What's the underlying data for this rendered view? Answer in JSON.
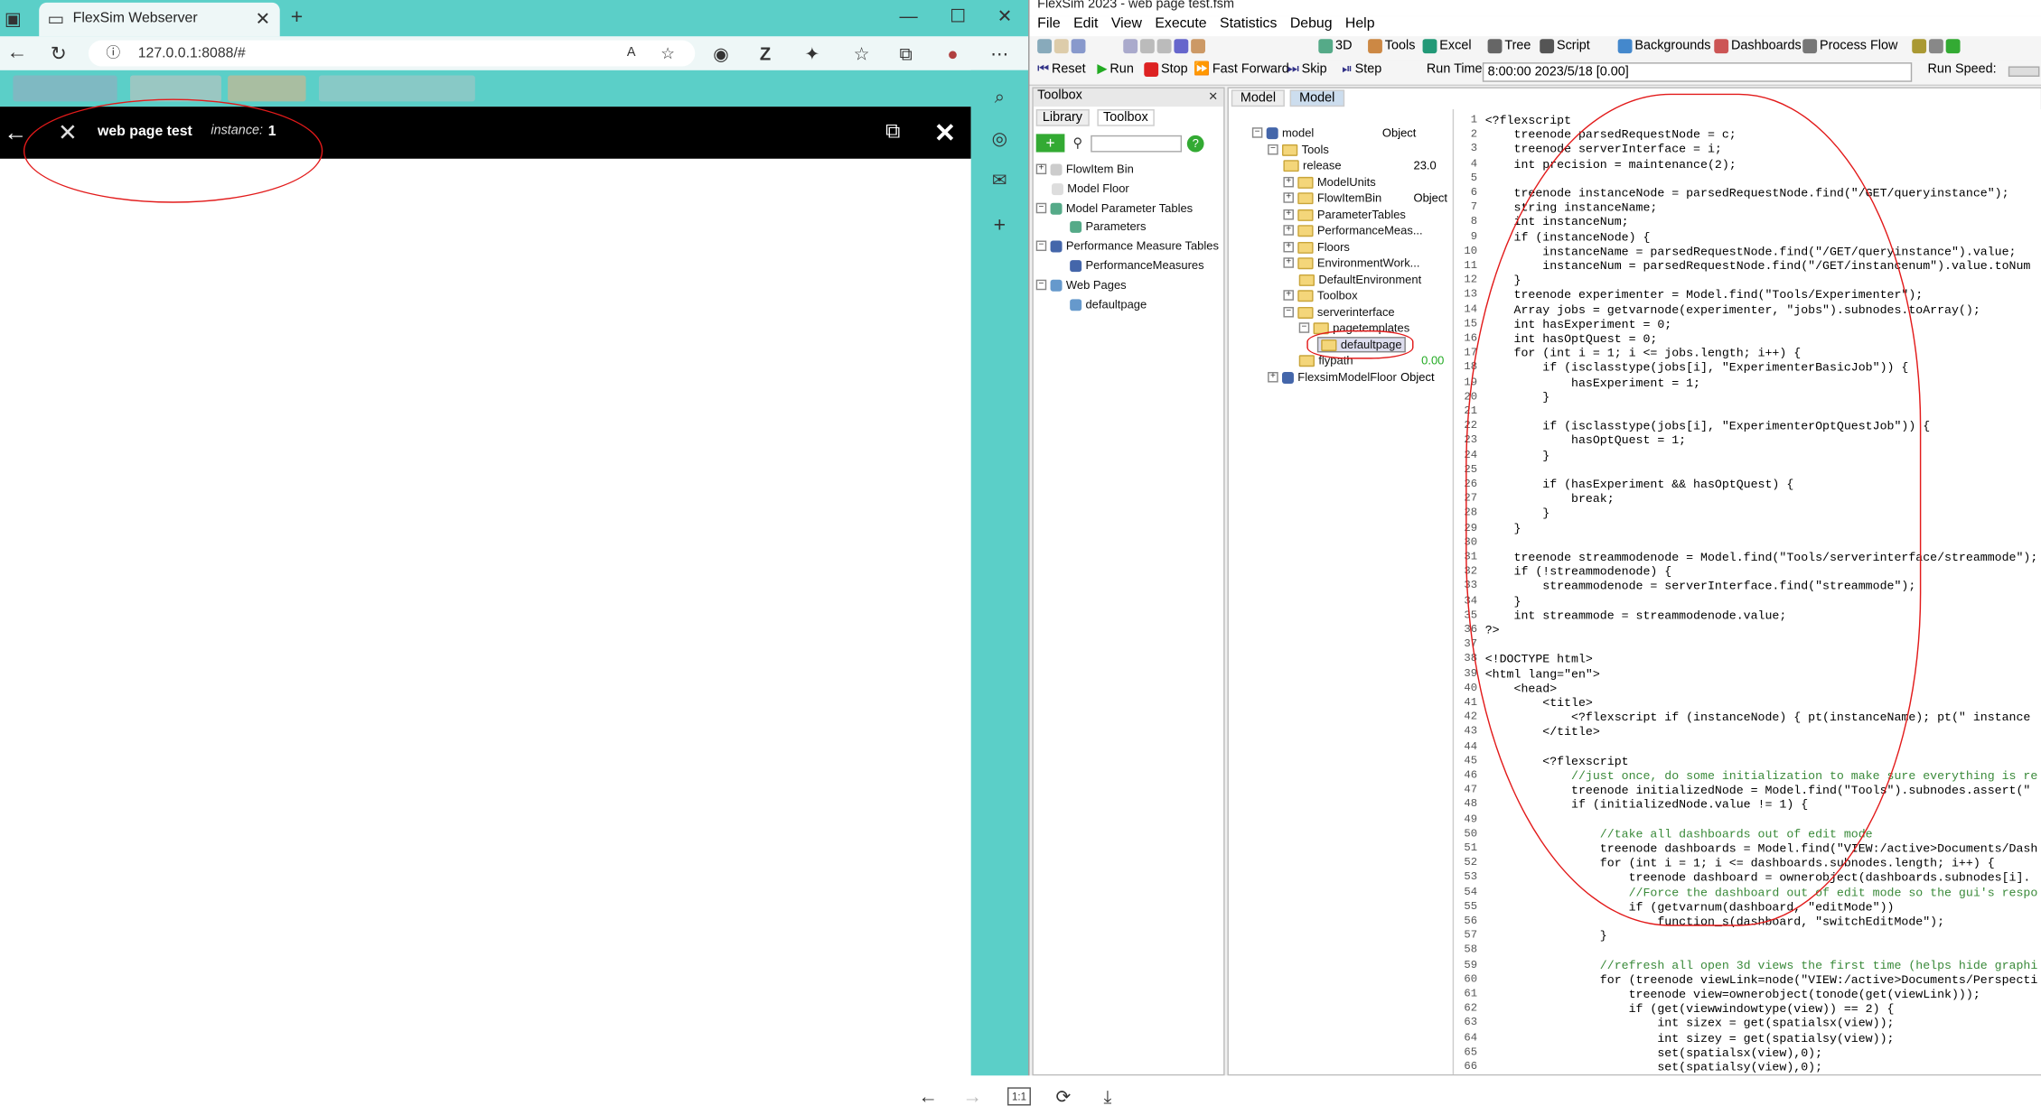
{
  "browser": {
    "tab_title": "FlexSim Webserver",
    "url": "127.0.0.1:8088/#",
    "app_title": "web page test",
    "instance_label": "instance:",
    "instance_value": "1"
  },
  "flexsim": {
    "window_title": "FlexSim 2023 - web page test.fsm",
    "menu": [
      "File",
      "Edit",
      "View",
      "Execute",
      "Statistics",
      "Debug",
      "Help"
    ],
    "toolbar": [
      "3D",
      "Tools",
      "Excel",
      "Tree",
      "Script",
      "Backgrounds",
      "Dashboards",
      "Process Flow"
    ],
    "run": {
      "reset": "Reset",
      "run": "Run",
      "stop": "Stop",
      "ff": "Fast Forward",
      "skip": "Skip",
      "step": "Step",
      "run_time_label": "Run Time:",
      "run_time": "8:00:00  2023/5/18  [0.00]",
      "run_speed_label": "Run Speed:"
    },
    "toolbox": {
      "title": "Toolbox",
      "tabs": [
        "Library",
        "Toolbox"
      ],
      "items": [
        "FlowItem Bin",
        "Model Floor",
        "Model Parameter Tables",
        "Parameters",
        "Performance Measure Tables",
        "PerformanceMeasures",
        "Web Pages",
        "defaultpage"
      ]
    },
    "model_tabs": [
      "Model",
      "Model"
    ],
    "tree": [
      {
        "name": "model",
        "value": "Object"
      },
      {
        "name": "Tools",
        "value": ""
      },
      {
        "name": "release",
        "value": "23.0"
      },
      {
        "name": "ModelUnits",
        "value": ""
      },
      {
        "name": "FlowItemBin",
        "value": "Object"
      },
      {
        "name": "ParameterTables",
        "value": ""
      },
      {
        "name": "PerformanceMeas...",
        "value": ""
      },
      {
        "name": "Floors",
        "value": ""
      },
      {
        "name": "EnvironmentWork...",
        "value": ""
      },
      {
        "name": "DefaultEnvironment",
        "value": ""
      },
      {
        "name": "Toolbox",
        "value": ""
      },
      {
        "name": "serverinterface",
        "value": ""
      },
      {
        "name": "pagetemplates",
        "value": ""
      },
      {
        "name": "defaultpage",
        "value": ""
      },
      {
        "name": "flypath",
        "value": "0.00"
      },
      {
        "name": "FlexsimModelFloor",
        "value": "Object"
      }
    ],
    "code": [
      "<?flexscript",
      "    treenode parsedRequestNode = c;",
      "    treenode serverInterface = i;",
      "    int precision = maintenance(2);",
      "",
      "    treenode instanceNode = parsedRequestNode.find(\"/GET/queryinstance\");",
      "    string instanceName;",
      "    int instanceNum;",
      "    if (instanceNode) {",
      "        instanceName = parsedRequestNode.find(\"/GET/queryinstance\").value;",
      "        instanceNum = parsedRequestNode.find(\"/GET/instancenum\").value.toNum",
      "    }",
      "    treenode experimenter = Model.find(\"Tools/Experimenter\");",
      "    Array jobs = getvarnode(experimenter, \"jobs\").subnodes.toArray();",
      "    int hasExperiment = 0;",
      "    int hasOptQuest = 0;",
      "    for (int i = 1; i <= jobs.length; i++) {",
      "        if (isclasstype(jobs[i], \"ExperimenterBasicJob\")) {",
      "            hasExperiment = 1;",
      "        }",
      "",
      "        if (isclasstype(jobs[i], \"ExperimenterOptQuestJob\")) {",
      "            hasOptQuest = 1;",
      "        }",
      "",
      "        if (hasExperiment && hasOptQuest) {",
      "            break;",
      "        }",
      "    }",
      "",
      "    treenode streammodenode = Model.find(\"Tools/serverinterface/streammode\");",
      "    if (!streammodenode) {",
      "        streammodenode = serverInterface.find(\"streammode\");",
      "    }",
      "    int streammode = streammodenode.value;",
      "?>",
      "",
      "<!DOCTYPE html>",
      "<html lang=\"en\">",
      "    <head>",
      "        <title>",
      "            <?flexscript if (instanceNode) { pt(instanceName); pt(\" instance",
      "        </title>",
      "",
      "        <?flexscript",
      "            //just once, do some initialization to make sure everything is re",
      "            treenode initializedNode = Model.find(\"Tools\").subnodes.assert(\"",
      "            if (initializedNode.value != 1) {",
      "",
      "                //take all dashboards out of edit mode",
      "                treenode dashboards = Model.find(\"VIEW:/active>Documents/Dash",
      "                for (int i = 1; i <= dashboards.subnodes.length; i++) {",
      "                    treenode dashboard = ownerobject(dashboards.subnodes[i].",
      "                    //Force the dashboard out of edit mode so the gui's respo",
      "                    if (getvarnum(dashboard, \"editMode\"))",
      "                        function_s(dashboard, \"switchEditMode\");",
      "                }",
      "",
      "                //refresh all open 3d views the first time (helps hide graphi",
      "                for (treenode viewLink=node(\"VIEW:/active>Documents/Perspecti",
      "                    treenode view=ownerobject(tonode(get(viewLink)));",
      "                    if (get(viewwindowtype(view)) == 2) {",
      "                        int sizex = get(spatialsx(view));",
      "                        int sizey = get(spatialsy(view));",
      "                        set(spatialsx(view),0);",
      "                        set(spatialsy(view),0);"
    ],
    "zoom_label": "1:1"
  }
}
